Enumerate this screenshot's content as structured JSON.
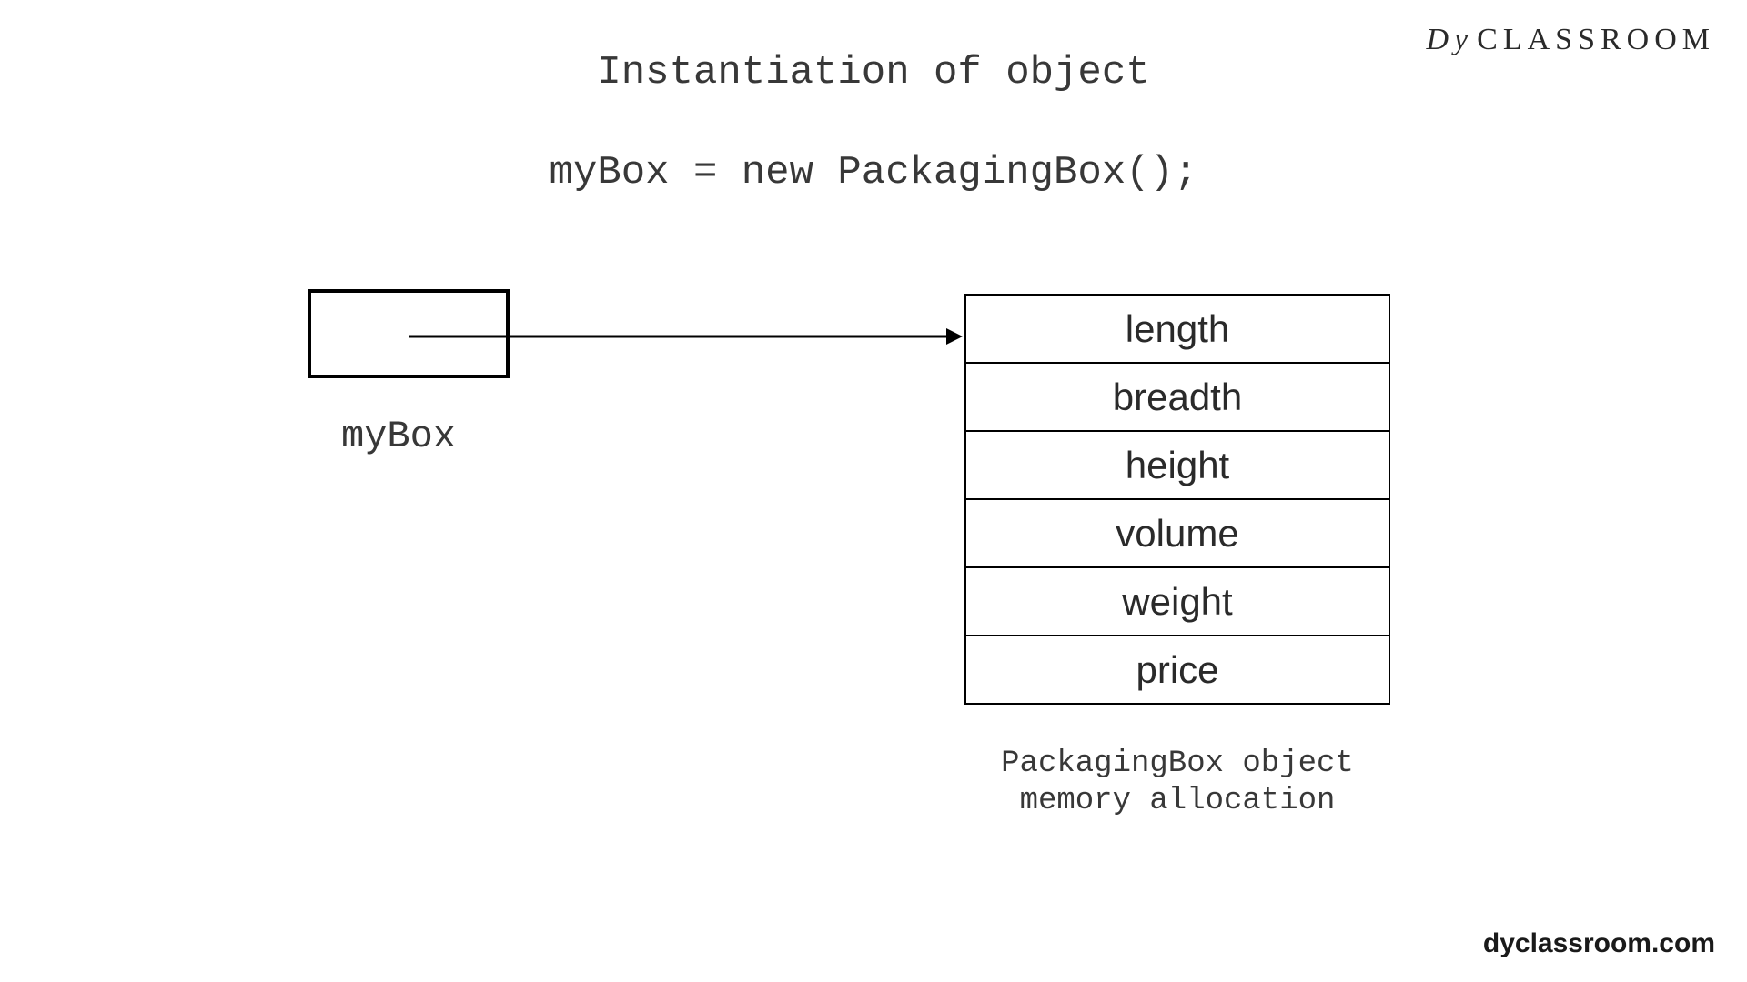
{
  "title": "Instantiation of object",
  "code": "myBox = new PackagingBox();",
  "logo": {
    "mark": "Dy",
    "text": "CLASSROOM"
  },
  "reference": {
    "label": "myBox"
  },
  "object": {
    "fields": [
      "length",
      "breadth",
      "height",
      "volume",
      "weight",
      "price"
    ],
    "caption_line1": "PackagingBox object",
    "caption_line2": "memory allocation"
  },
  "footer": "dyclassroom.com"
}
